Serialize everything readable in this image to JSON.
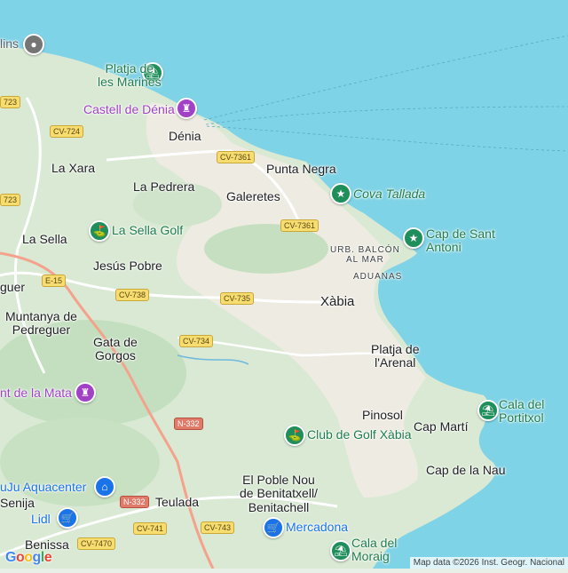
{
  "map": {
    "places": [
      {
        "key": "dinlins",
        "text": "lins"
      },
      {
        "key": "platja_marines",
        "text": "Platja de\nles Marines"
      },
      {
        "key": "castell",
        "text": "Castell de Dénia"
      },
      {
        "key": "denia",
        "text": "Dénia"
      },
      {
        "key": "la_xara",
        "text": "La Xara"
      },
      {
        "key": "punta_negra",
        "text": "Punta Negra"
      },
      {
        "key": "cova_tallada",
        "text": "Cova Tallada"
      },
      {
        "key": "la_pedrera",
        "text": "La Pedrera"
      },
      {
        "key": "galeretes",
        "text": "Galeretes"
      },
      {
        "key": "la_sella_golf",
        "text": "La Sella Golf"
      },
      {
        "key": "la_sella",
        "text": "La Sella"
      },
      {
        "key": "cap_sant_antoni",
        "text": "Cap de Sant\nAntoni"
      },
      {
        "key": "urb_balcon",
        "text": "URB. BALCÓN\nAL MAR"
      },
      {
        "key": "jesus_pobre",
        "text": "Jesús Pobre"
      },
      {
        "key": "aduanas",
        "text": "ADUANAS"
      },
      {
        "key": "pedreguer",
        "text": "guer"
      },
      {
        "key": "xabia",
        "text": "Xàbia"
      },
      {
        "key": "muntanya",
        "text": "Muntanya de\nPedreguer"
      },
      {
        "key": "gata",
        "text": "Gata de\nGorgos"
      },
      {
        "key": "platja_arenal",
        "text": "Platja de\nl'Arenal"
      },
      {
        "key": "mata",
        "text": "nt de la Mata"
      },
      {
        "key": "cala_portixol",
        "text": "Cala del\nPortitxol"
      },
      {
        "key": "pinosol",
        "text": "Pinosol"
      },
      {
        "key": "cap_marti",
        "text": "Cap Martí"
      },
      {
        "key": "club_golf",
        "text": "Club de Golf Xàbia"
      },
      {
        "key": "cap_nau",
        "text": "Cap de la Nau"
      },
      {
        "key": "aquacenter",
        "text": "uJu Aquacenter"
      },
      {
        "key": "poble_nou",
        "text": "El Poble Nou\nde Benitatxell/\nBenitachell"
      },
      {
        "key": "senija",
        "text": "Senija"
      },
      {
        "key": "teulada",
        "text": "Teulada"
      },
      {
        "key": "lidl",
        "text": "Lidl"
      },
      {
        "key": "mercadona",
        "text": "Mercadona"
      },
      {
        "key": "benissa",
        "text": "Benissa"
      },
      {
        "key": "cala_moraig",
        "text": "Cala del\nMoraig"
      }
    ],
    "roads": [
      "723",
      "CV-724",
      "CV-7361",
      "CV-7361",
      "723",
      "E-15",
      "CV-738",
      "CV-735",
      "CV-734",
      "N-332",
      "N-332",
      "CV-741",
      "CV-743",
      "CV-7470"
    ],
    "attribution": "Map data ©2026 Inst. Geogr. Nacional",
    "logo": [
      "G",
      "o",
      "o",
      "g",
      "l",
      "e"
    ],
    "colors": {
      "sea": "#7fd3e6",
      "land_green": "#d5e8d0",
      "land_urban": "#f1efe9",
      "road_major": "#f7dc6f",
      "road_national": "#e07b6a"
    }
  }
}
